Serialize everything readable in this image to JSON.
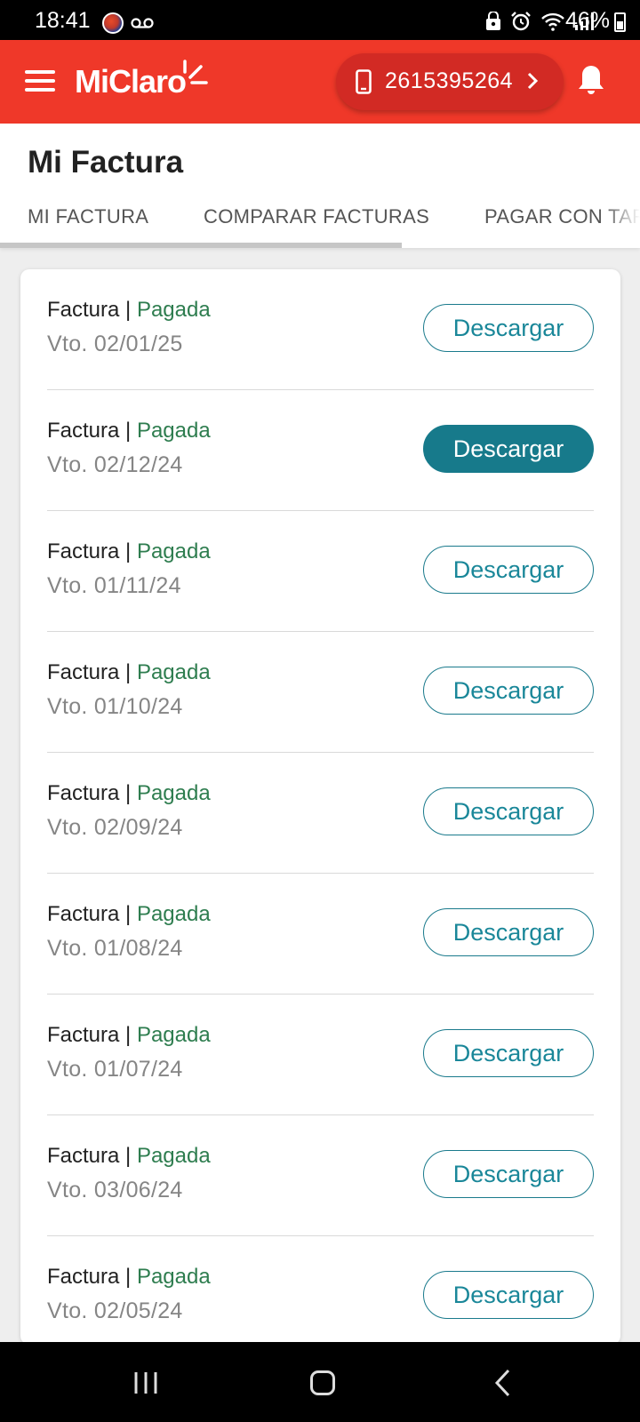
{
  "status_bar": {
    "time": "18:41",
    "battery": "46%",
    "icons_left": [
      "app-avatar-icon",
      "voicemail-icon"
    ],
    "icons_right": [
      "lock-icon",
      "alarm-icon",
      "wifi-icon",
      "signal-icon",
      "battery-icon"
    ]
  },
  "app_bar": {
    "brand": "MiClaro",
    "phone_number": "2615395264",
    "colors": {
      "primary": "#ef3829",
      "pill": "#d22a24"
    }
  },
  "page": {
    "title": "Mi Factura",
    "tabs": [
      {
        "label": "MI FACTURA"
      },
      {
        "label": "COMPARAR FACTURAS"
      },
      {
        "label": "PAGAR CON TARJETA"
      }
    ]
  },
  "invoices": {
    "colors": {
      "status": "#2e7d4f",
      "button": "#1a7a8c"
    },
    "items": [
      {
        "title": "Factura",
        "sep": "|",
        "status": "Pagada",
        "due": "Vto. 02/01/25",
        "button": "Descargar"
      },
      {
        "title": "Factura",
        "sep": "|",
        "status": "Pagada",
        "due": "Vto. 02/12/24",
        "button": "Descargar"
      },
      {
        "title": "Factura",
        "sep": "|",
        "status": "Pagada",
        "due": "Vto. 01/11/24",
        "button": "Descargar"
      },
      {
        "title": "Factura",
        "sep": "|",
        "status": "Pagada",
        "due": "Vto. 01/10/24",
        "button": "Descargar"
      },
      {
        "title": "Factura",
        "sep": "|",
        "status": "Pagada",
        "due": "Vto. 02/09/24",
        "button": "Descargar"
      },
      {
        "title": "Factura",
        "sep": "|",
        "status": "Pagada",
        "due": "Vto. 01/08/24",
        "button": "Descargar"
      },
      {
        "title": "Factura",
        "sep": "|",
        "status": "Pagada",
        "due": "Vto. 01/07/24",
        "button": "Descargar"
      },
      {
        "title": "Factura",
        "sep": "|",
        "status": "Pagada",
        "due": "Vto. 03/06/24",
        "button": "Descargar"
      },
      {
        "title": "Factura",
        "sep": "|",
        "status": "Pagada",
        "due": "Vto. 02/05/24",
        "button": "Descargar"
      }
    ]
  }
}
